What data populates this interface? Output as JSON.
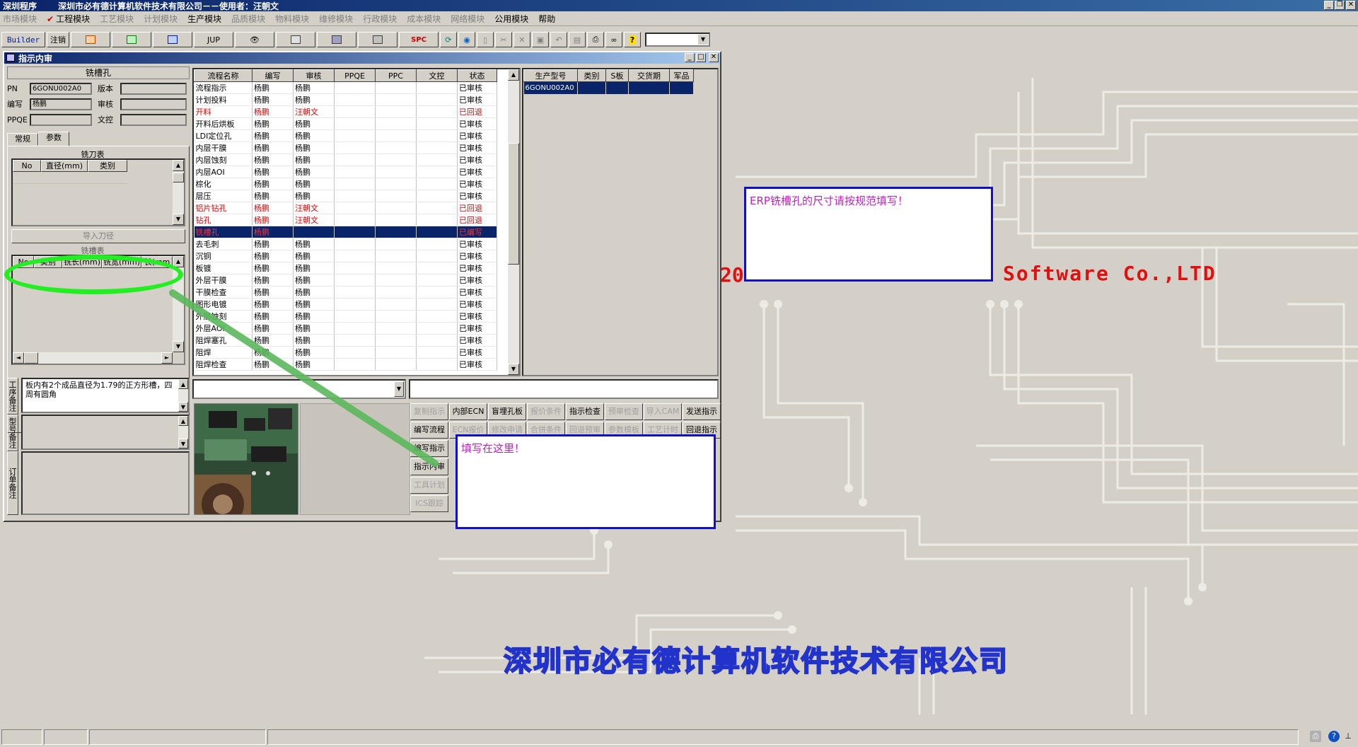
{
  "window": {
    "app_name": "深圳程序",
    "title": "深圳市必有德计算机软件技术有限公司－－使用者：汪朝文"
  },
  "menu": {
    "items": [
      {
        "label": "市场模块",
        "enabled": false
      },
      {
        "label": "工程模块",
        "enabled": true,
        "checked": true
      },
      {
        "label": "工艺模块",
        "enabled": false
      },
      {
        "label": "计划模块",
        "enabled": false
      },
      {
        "label": "生产模块",
        "enabled": true
      },
      {
        "label": "品质模块",
        "enabled": false
      },
      {
        "label": "物料模块",
        "enabled": false
      },
      {
        "label": "维修模块",
        "enabled": false
      },
      {
        "label": "行政模块",
        "enabled": false
      },
      {
        "label": "成本模块",
        "enabled": false
      },
      {
        "label": "网络模块",
        "enabled": false
      },
      {
        "label": "公用模块",
        "enabled": true
      },
      {
        "label": "帮助",
        "enabled": true
      }
    ]
  },
  "toolbar": {
    "builder": "Builder",
    "logout": "注销",
    "jup": "JUP",
    "spc": "SPC"
  },
  "background": {
    "company_en_prefix": "20",
    "company_en": "Software Co.,LTD",
    "company_cn": "深圳市必有德计算机软件技术有限公司"
  },
  "mdi": {
    "title": "指示内审"
  },
  "left": {
    "process_name": "铣槽孔",
    "pn_label": "PN",
    "pn_value": "6GONU002A0",
    "version_label": "版本",
    "version_value": "",
    "author_label": "编写",
    "author_value": "杨鹏",
    "reviewer_label": "审核",
    "reviewer_value": "",
    "ppqe_label": "PPQE",
    "ppqe_value": "",
    "doc_label": "文控",
    "doc_value": "",
    "tab_general": "常规",
    "tab_params": "参数",
    "tool_table_caption": "铣刀表",
    "tool_headers": [
      "No",
      "直径(mm)",
      "类别"
    ],
    "import_tool": "导入刀径",
    "slot_caption": "铣槽表",
    "slot_headers": [
      "No",
      "类别",
      "铣长(mm)",
      "铣宽(mm)",
      "长(mm"
    ],
    "process_note_label": "工序备注",
    "process_note": "板内有2个成品直径为1.79的正方形槽，四周有圆角",
    "model_note_label": "型号备注",
    "model_note": "",
    "order_note_label": "订单备注",
    "order_note": ""
  },
  "process_table": {
    "headers": [
      "流程名称",
      "编写",
      "审核",
      "PPQE",
      "PPC",
      "文控",
      "状态"
    ],
    "rows": [
      {
        "name": "流程指示",
        "author": "杨鹏",
        "reviewer": "杨鹏",
        "status": "已审核",
        "style": "normal"
      },
      {
        "name": "计划投料",
        "author": "杨鹏",
        "reviewer": "杨鹏",
        "status": "已审核",
        "style": "normal"
      },
      {
        "name": "开料",
        "author": "杨鹏",
        "reviewer": "汪朝文",
        "status": "已回退",
        "style": "red"
      },
      {
        "name": "开料后烘板",
        "author": "杨鹏",
        "reviewer": "杨鹏",
        "status": "已审核",
        "style": "normal"
      },
      {
        "name": "LDI定位孔",
        "author": "杨鹏",
        "reviewer": "杨鹏",
        "status": "已审核",
        "style": "normal"
      },
      {
        "name": "内层干膜",
        "author": "杨鹏",
        "reviewer": "杨鹏",
        "status": "已审核",
        "style": "normal"
      },
      {
        "name": "内层蚀刻",
        "author": "杨鹏",
        "reviewer": "杨鹏",
        "status": "已审核",
        "style": "normal"
      },
      {
        "name": "内层AOI",
        "author": "杨鹏",
        "reviewer": "杨鹏",
        "status": "已审核",
        "style": "normal"
      },
      {
        "name": "棕化",
        "author": "杨鹏",
        "reviewer": "杨鹏",
        "status": "已审核",
        "style": "normal"
      },
      {
        "name": "层压",
        "author": "杨鹏",
        "reviewer": "杨鹏",
        "status": "已审核",
        "style": "normal"
      },
      {
        "name": "铝片钻孔",
        "author": "杨鹏",
        "reviewer": "汪朝文",
        "status": "已回退",
        "style": "red"
      },
      {
        "name": "钻孔",
        "author": "杨鹏",
        "reviewer": "汪朝文",
        "status": "已回退",
        "style": "red"
      },
      {
        "name": "铣槽孔",
        "author": "杨鹏",
        "reviewer": "",
        "status": "已编写",
        "style": "selected"
      },
      {
        "name": "去毛刺",
        "author": "杨鹏",
        "reviewer": "杨鹏",
        "status": "已审核",
        "style": "normal"
      },
      {
        "name": "沉铜",
        "author": "杨鹏",
        "reviewer": "杨鹏",
        "status": "已审核",
        "style": "normal"
      },
      {
        "name": "板镀",
        "author": "杨鹏",
        "reviewer": "杨鹏",
        "status": "已审核",
        "style": "normal"
      },
      {
        "name": "外层干膜",
        "author": "杨鹏",
        "reviewer": "杨鹏",
        "status": "已审核",
        "style": "normal"
      },
      {
        "name": "干膜检查",
        "author": "杨鹏",
        "reviewer": "杨鹏",
        "status": "已审核",
        "style": "normal"
      },
      {
        "name": "图形电镀",
        "author": "杨鹏",
        "reviewer": "杨鹏",
        "status": "已审核",
        "style": "normal"
      },
      {
        "name": "外层蚀刻",
        "author": "杨鹏",
        "reviewer": "杨鹏",
        "status": "已审核",
        "style": "normal"
      },
      {
        "name": "外层AOI",
        "author": "杨鹏",
        "reviewer": "杨鹏",
        "status": "已审核",
        "style": "normal"
      },
      {
        "name": "阻焊塞孔",
        "author": "杨鹏",
        "reviewer": "杨鹏",
        "status": "已审核",
        "style": "normal"
      },
      {
        "name": "阻焊",
        "author": "杨鹏",
        "reviewer": "杨鹏",
        "status": "已审核",
        "style": "normal"
      },
      {
        "name": "阻焊检查",
        "author": "杨鹏",
        "reviewer": "杨鹏",
        "status": "已审核",
        "style": "normal"
      }
    ]
  },
  "product_table": {
    "headers": [
      "生产型号",
      "类别",
      "S板",
      "交货期",
      "军品"
    ],
    "rows": [
      {
        "model": "6GONU002A0",
        "type": "",
        "s": "",
        "due": "",
        "mil": ""
      }
    ]
  },
  "actions": {
    "buttons": [
      {
        "label": "复制指示",
        "enabled": false
      },
      {
        "label": "内部ECN",
        "enabled": true
      },
      {
        "label": "盲埋孔板",
        "enabled": true
      },
      {
        "label": "报价条件",
        "enabled": false
      },
      {
        "label": "指示检查",
        "enabled": true
      },
      {
        "label": "预审检查",
        "enabled": false
      },
      {
        "label": "导入CAM",
        "enabled": false
      },
      {
        "label": "发送指示",
        "enabled": true
      },
      {
        "label": "编写流程",
        "enabled": true
      },
      {
        "label": "ECN报价",
        "enabled": false
      },
      {
        "label": "修改申请",
        "enabled": false
      },
      {
        "label": "合拼条件",
        "enabled": false
      },
      {
        "label": "回退预审",
        "enabled": false
      },
      {
        "label": "参数模板",
        "enabled": false
      },
      {
        "label": "工艺计时",
        "enabled": false
      },
      {
        "label": "回退指示",
        "enabled": true
      },
      {
        "label": "编写指示",
        "enabled": true
      },
      {
        "label": "指示内审",
        "enabled": true
      },
      {
        "label": "工具计划",
        "enabled": false
      },
      {
        "label": "ICS跟踪",
        "enabled": false
      }
    ]
  },
  "callouts": {
    "erp": "ERP铣槽孔的尺寸请按规范填写！",
    "fill_here": "填写在这里！"
  },
  "colors": {
    "title_blue": "#0a246a",
    "red_text": "#e00000",
    "callout_border": "#1010c8",
    "callout_text": "#c020c0",
    "highlight_green": "#22ee22",
    "arrow_green": "#5cb85c"
  }
}
